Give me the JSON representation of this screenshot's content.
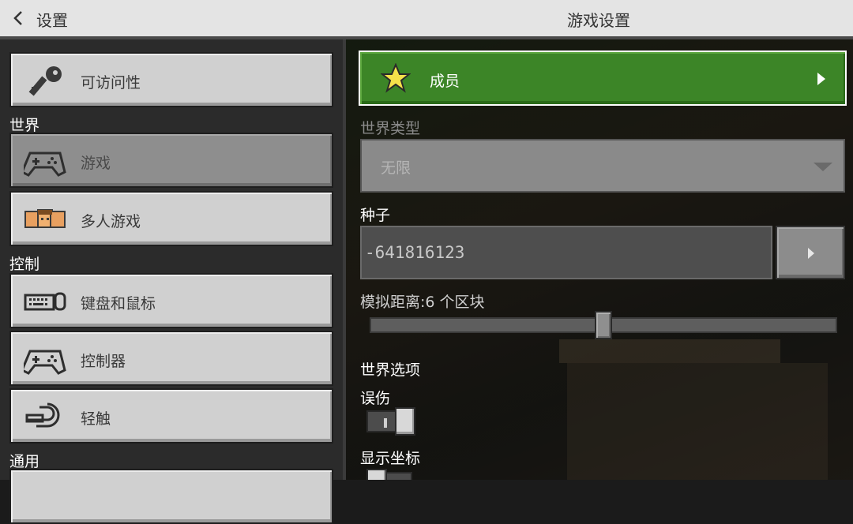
{
  "header": {
    "back_label": "设置",
    "title": "游戏设置"
  },
  "sidebar": {
    "top_item": {
      "label": "可访问性",
      "icon": "key-icon"
    },
    "sections": [
      {
        "label": "世界",
        "items": [
          {
            "label": "游戏",
            "icon": "gamepad-icon",
            "selected": true
          },
          {
            "label": "多人游戏",
            "icon": "players-icon",
            "selected": false
          }
        ]
      },
      {
        "label": "控制",
        "items": [
          {
            "label": "键盘和鼠标",
            "icon": "keyboard-mouse-icon",
            "selected": false
          },
          {
            "label": "控制器",
            "icon": "controller-icon",
            "selected": false
          },
          {
            "label": "轻触",
            "icon": "touch-icon",
            "selected": false
          }
        ]
      },
      {
        "label": "通用",
        "items": []
      }
    ]
  },
  "main": {
    "permission_button": {
      "label": "成员",
      "icon": "star-icon"
    },
    "world_type": {
      "label": "世界类型",
      "value": "无限"
    },
    "seed": {
      "label": "种子",
      "value": "-641816123"
    },
    "simulation_distance": {
      "label": "模拟距离:6 个区块",
      "value": 6,
      "min": 4,
      "max": 8
    },
    "world_options": {
      "heading": "世界选项",
      "toggles": [
        {
          "label": "误伤",
          "on": true
        },
        {
          "label": "显示坐标",
          "on": false
        }
      ]
    }
  },
  "colors": {
    "accent_green": "#3c8527",
    "button_grey": "#d0d0d0",
    "selected_grey": "#8e8e8e"
  }
}
